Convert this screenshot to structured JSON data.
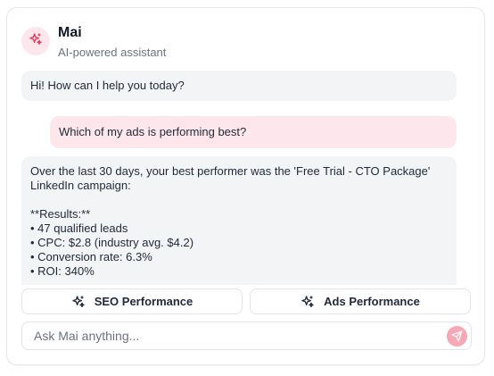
{
  "assistant": {
    "name": "Mai",
    "subtitle": "AI-powered assistant",
    "avatar_icon": "sparkle-icon"
  },
  "messages": [
    {
      "role": "assistant",
      "lines": [
        "Hi! How can I help you today?"
      ]
    },
    {
      "role": "user",
      "lines": [
        "Which of my ads is performing best?"
      ]
    },
    {
      "role": "assistant",
      "lines": [
        "Over the last 30 days, your best performer was the 'Free Trial - CTO Package'",
        "LinkedIn campaign:",
        "",
        "**Results:**",
        "• 47 qualified leads",
        "• CPC: $2.8 (industry avg. $4.2)",
        "• Conversion rate: 6.3%",
        "• ROI: 340%",
        "",
        ""
      ]
    }
  ],
  "quick_actions": [
    {
      "label": "SEO Performance",
      "icon": "sparkle-icon"
    },
    {
      "label": "Ads Performance",
      "icon": "sparkle-icon"
    }
  ],
  "input": {
    "placeholder": "Ask Mai anything...",
    "value": "",
    "send_icon": "send-icon"
  },
  "colors": {
    "accent": "#e8375a",
    "accent_soft": "#fde7ec",
    "send_button": "#f6a8b6",
    "assistant_bubble": "#f3f4f6",
    "border": "#e1e3e8"
  }
}
